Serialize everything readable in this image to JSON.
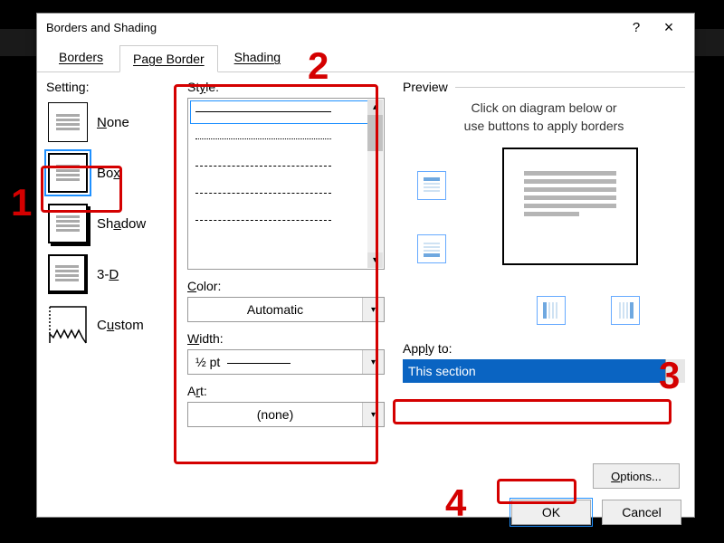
{
  "dialog": {
    "title": "Borders and Shading",
    "help_tooltip": "?",
    "close_tooltip": "×"
  },
  "tabs": {
    "borders": "Borders",
    "page_border": "Page Border",
    "shading": "Shading",
    "active": "page_border"
  },
  "settings": {
    "label": "Setting:",
    "none": "None",
    "box": "Box",
    "shadow": "Shadow",
    "three_d": "3-D",
    "custom": "Custom",
    "selected": "box"
  },
  "style": {
    "label": "Style:",
    "options": [
      "solid",
      "dotted",
      "dashed",
      "dash-short",
      "dash-dot-dot"
    ],
    "selected_index": 0,
    "color_label": "Color:",
    "color_value": "Automatic",
    "width_label": "Width:",
    "width_value": "½ pt",
    "art_label": "Art:",
    "art_value": "(none)"
  },
  "preview": {
    "label": "Preview",
    "hint_line1": "Click on diagram below or",
    "hint_line2": "use buttons to apply borders",
    "apply_to_label": "Apply to:",
    "apply_to_value": "This section",
    "options_btn": "Options..."
  },
  "footer": {
    "ok": "OK",
    "cancel": "Cancel"
  },
  "callouts": {
    "1": "1",
    "2": "2",
    "3": "3",
    "4": "4"
  }
}
